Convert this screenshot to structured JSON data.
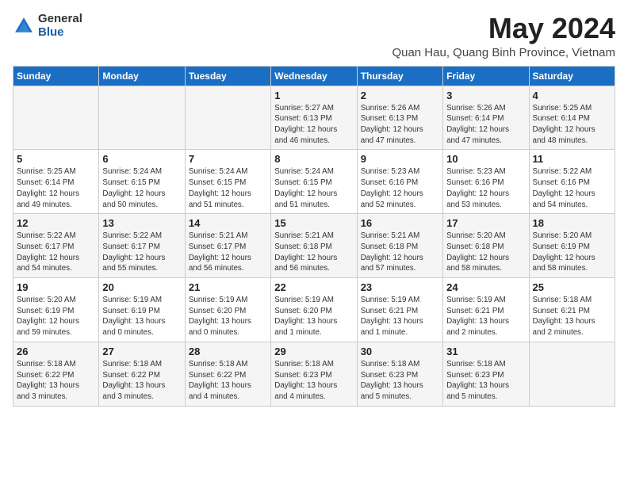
{
  "logo": {
    "general": "General",
    "blue": "Blue"
  },
  "title": "May 2024",
  "subtitle": "Quan Hau, Quang Binh Province, Vietnam",
  "headers": [
    "Sunday",
    "Monday",
    "Tuesday",
    "Wednesday",
    "Thursday",
    "Friday",
    "Saturday"
  ],
  "weeks": [
    [
      {
        "day": "",
        "info": ""
      },
      {
        "day": "",
        "info": ""
      },
      {
        "day": "",
        "info": ""
      },
      {
        "day": "1",
        "info": "Sunrise: 5:27 AM\nSunset: 6:13 PM\nDaylight: 12 hours\nand 46 minutes."
      },
      {
        "day": "2",
        "info": "Sunrise: 5:26 AM\nSunset: 6:13 PM\nDaylight: 12 hours\nand 47 minutes."
      },
      {
        "day": "3",
        "info": "Sunrise: 5:26 AM\nSunset: 6:14 PM\nDaylight: 12 hours\nand 47 minutes."
      },
      {
        "day": "4",
        "info": "Sunrise: 5:25 AM\nSunset: 6:14 PM\nDaylight: 12 hours\nand 48 minutes."
      }
    ],
    [
      {
        "day": "5",
        "info": "Sunrise: 5:25 AM\nSunset: 6:14 PM\nDaylight: 12 hours\nand 49 minutes."
      },
      {
        "day": "6",
        "info": "Sunrise: 5:24 AM\nSunset: 6:15 PM\nDaylight: 12 hours\nand 50 minutes."
      },
      {
        "day": "7",
        "info": "Sunrise: 5:24 AM\nSunset: 6:15 PM\nDaylight: 12 hours\nand 51 minutes."
      },
      {
        "day": "8",
        "info": "Sunrise: 5:24 AM\nSunset: 6:15 PM\nDaylight: 12 hours\nand 51 minutes."
      },
      {
        "day": "9",
        "info": "Sunrise: 5:23 AM\nSunset: 6:16 PM\nDaylight: 12 hours\nand 52 minutes."
      },
      {
        "day": "10",
        "info": "Sunrise: 5:23 AM\nSunset: 6:16 PM\nDaylight: 12 hours\nand 53 minutes."
      },
      {
        "day": "11",
        "info": "Sunrise: 5:22 AM\nSunset: 6:16 PM\nDaylight: 12 hours\nand 54 minutes."
      }
    ],
    [
      {
        "day": "12",
        "info": "Sunrise: 5:22 AM\nSunset: 6:17 PM\nDaylight: 12 hours\nand 54 minutes."
      },
      {
        "day": "13",
        "info": "Sunrise: 5:22 AM\nSunset: 6:17 PM\nDaylight: 12 hours\nand 55 minutes."
      },
      {
        "day": "14",
        "info": "Sunrise: 5:21 AM\nSunset: 6:17 PM\nDaylight: 12 hours\nand 56 minutes."
      },
      {
        "day": "15",
        "info": "Sunrise: 5:21 AM\nSunset: 6:18 PM\nDaylight: 12 hours\nand 56 minutes."
      },
      {
        "day": "16",
        "info": "Sunrise: 5:21 AM\nSunset: 6:18 PM\nDaylight: 12 hours\nand 57 minutes."
      },
      {
        "day": "17",
        "info": "Sunrise: 5:20 AM\nSunset: 6:18 PM\nDaylight: 12 hours\nand 58 minutes."
      },
      {
        "day": "18",
        "info": "Sunrise: 5:20 AM\nSunset: 6:19 PM\nDaylight: 12 hours\nand 58 minutes."
      }
    ],
    [
      {
        "day": "19",
        "info": "Sunrise: 5:20 AM\nSunset: 6:19 PM\nDaylight: 12 hours\nand 59 minutes."
      },
      {
        "day": "20",
        "info": "Sunrise: 5:19 AM\nSunset: 6:19 PM\nDaylight: 13 hours\nand 0 minutes."
      },
      {
        "day": "21",
        "info": "Sunrise: 5:19 AM\nSunset: 6:20 PM\nDaylight: 13 hours\nand 0 minutes."
      },
      {
        "day": "22",
        "info": "Sunrise: 5:19 AM\nSunset: 6:20 PM\nDaylight: 13 hours\nand 1 minute."
      },
      {
        "day": "23",
        "info": "Sunrise: 5:19 AM\nSunset: 6:21 PM\nDaylight: 13 hours\nand 1 minute."
      },
      {
        "day": "24",
        "info": "Sunrise: 5:19 AM\nSunset: 6:21 PM\nDaylight: 13 hours\nand 2 minutes."
      },
      {
        "day": "25",
        "info": "Sunrise: 5:18 AM\nSunset: 6:21 PM\nDaylight: 13 hours\nand 2 minutes."
      }
    ],
    [
      {
        "day": "26",
        "info": "Sunrise: 5:18 AM\nSunset: 6:22 PM\nDaylight: 13 hours\nand 3 minutes."
      },
      {
        "day": "27",
        "info": "Sunrise: 5:18 AM\nSunset: 6:22 PM\nDaylight: 13 hours\nand 3 minutes."
      },
      {
        "day": "28",
        "info": "Sunrise: 5:18 AM\nSunset: 6:22 PM\nDaylight: 13 hours\nand 4 minutes."
      },
      {
        "day": "29",
        "info": "Sunrise: 5:18 AM\nSunset: 6:23 PM\nDaylight: 13 hours\nand 4 minutes."
      },
      {
        "day": "30",
        "info": "Sunrise: 5:18 AM\nSunset: 6:23 PM\nDaylight: 13 hours\nand 5 minutes."
      },
      {
        "day": "31",
        "info": "Sunrise: 5:18 AM\nSunset: 6:23 PM\nDaylight: 13 hours\nand 5 minutes."
      },
      {
        "day": "",
        "info": ""
      }
    ]
  ]
}
